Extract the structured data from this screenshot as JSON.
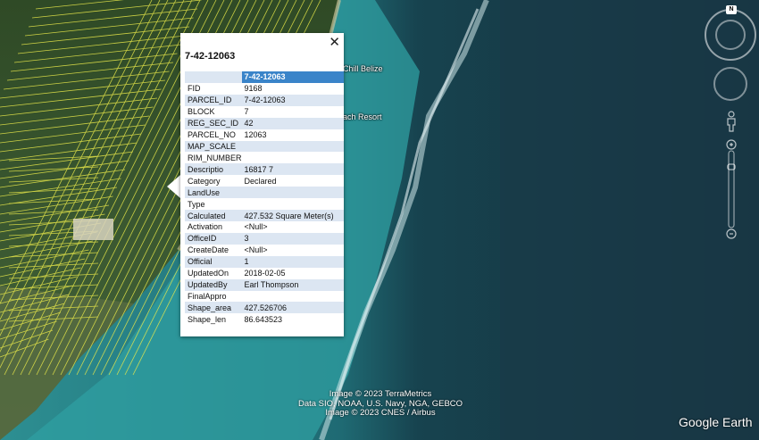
{
  "map": {
    "place_labels": [
      "Chill Belize",
      "ach Resort"
    ],
    "attribution": [
      "Image © 2023 TerraMetrics",
      "Data SIO, NOAA, U.S. Navy, NGA, GEBCO",
      "Image © 2023 CNES / Airbus"
    ],
    "logo": "Google Earth",
    "compass_label": "N",
    "colors": {
      "parcel_lines": "#e8e84a",
      "land": "#3b5a2c",
      "shallow_water": "#2f9a9e",
      "deep_water": "#163846",
      "reef": "#cfe8ea"
    }
  },
  "popup": {
    "title": "7-42-12063",
    "close_icon": "close-icon",
    "header_value": "7-42-12063",
    "attributes": [
      {
        "key": "FID",
        "value": "9168"
      },
      {
        "key": "PARCEL_ID",
        "value": "7-42-12063"
      },
      {
        "key": "BLOCK",
        "value": "7"
      },
      {
        "key": "REG_SEC_ID",
        "value": "42"
      },
      {
        "key": "PARCEL_NO",
        "value": "12063"
      },
      {
        "key": "MAP_SCALE",
        "value": ""
      },
      {
        "key": "RIM_NUMBER",
        "value": ""
      },
      {
        "key": "Descriptio",
        "value": "16817 7"
      },
      {
        "key": "Category",
        "value": "Declared"
      },
      {
        "key": "LandUse",
        "value": ""
      },
      {
        "key": "Type",
        "value": ""
      },
      {
        "key": "Calculated",
        "value": "427.532 Square Meter(s)"
      },
      {
        "key": "Activation",
        "value": "<Null>"
      },
      {
        "key": "OfficeID",
        "value": "3"
      },
      {
        "key": "CreateDate",
        "value": "<Null>"
      },
      {
        "key": "Official",
        "value": "1"
      },
      {
        "key": "UpdatedOn",
        "value": "2018-02-05"
      },
      {
        "key": "UpdatedBy",
        "value": "Earl Thompson"
      },
      {
        "key": "FinalAppro",
        "value": ""
      },
      {
        "key": "Shape_area",
        "value": "427.526706"
      },
      {
        "key": "Shape_len",
        "value": "86.643523"
      }
    ]
  }
}
